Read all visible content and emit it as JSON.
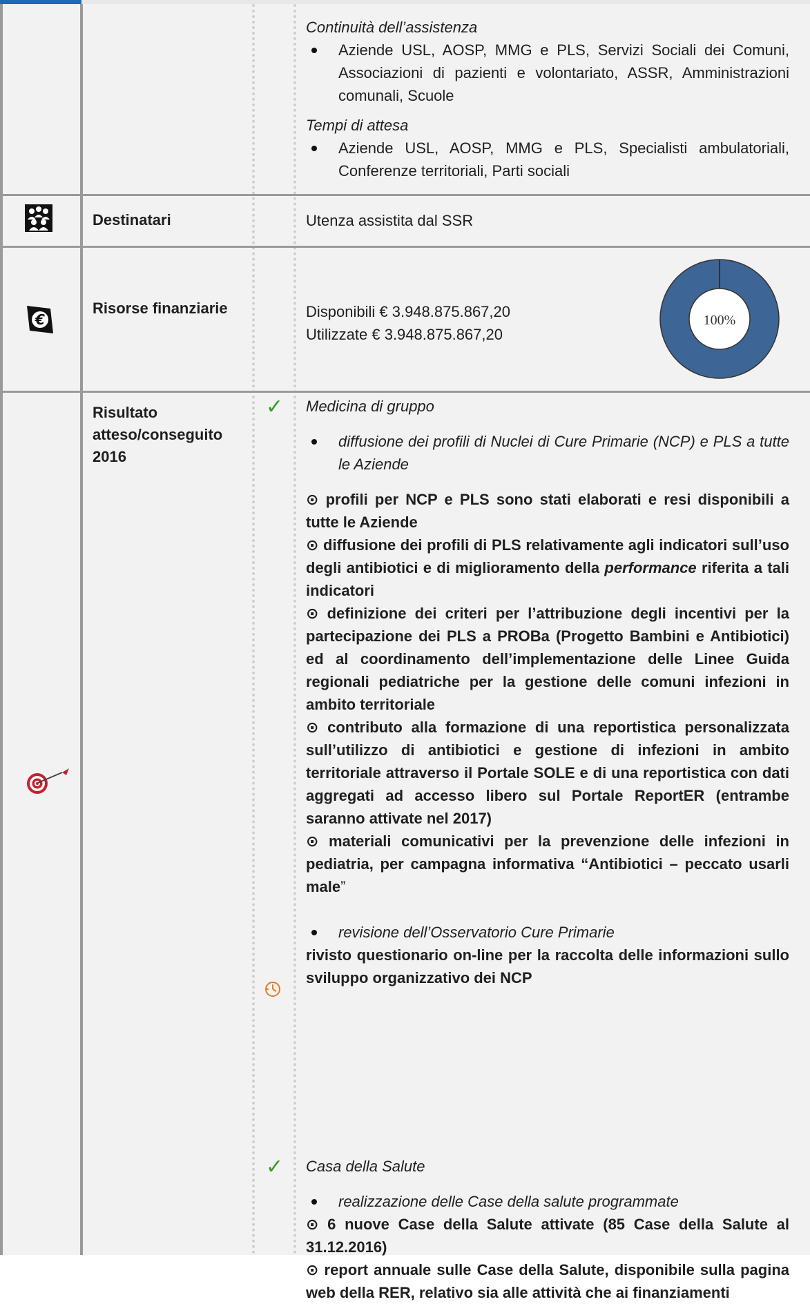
{
  "continuity": {
    "heading": "Continuità dell’assistenza",
    "item": "Aziende USL, AOSP, MMG e PLS, Servizi Sociali dei Comuni, Associazioni di pazienti e volontariato, ASSR, Amministrazioni comunali, Scuole"
  },
  "waiting": {
    "heading": "Tempi di attesa",
    "item": "Aziende USL, AOSP, MMG e PLS, Specialisti ambulatoriali, Conferenze territoriali, Parti sociali"
  },
  "recipients": {
    "label": "Destinatari",
    "value": "Utenza assistita dal SSR",
    "icon": "people-icon"
  },
  "resources": {
    "label": "Risorse finanziarie",
    "available": "Disponibili € 3.948.875.867,20",
    "used": "Utilizzate € 3.948.875.867,20",
    "icon": "euro-icon",
    "chart_data": {
      "type": "pie",
      "categories": [
        "Utilizzate"
      ],
      "values": [
        100
      ],
      "center_label": "100%",
      "colors": [
        "#3d6595"
      ]
    }
  },
  "results": {
    "label": "Risultato atteso/conseguito 2016",
    "icon": "target-icon",
    "status_colors": {
      "achieved": "#3a9a28",
      "in_progress": "#e87b1e"
    },
    "group": {
      "heading": "Medicina di gruppo",
      "bullet1": "diffusione dei profili di Nuclei di Cure Primarie (NCP) e PLS a tutte le Aziende",
      "o1": "⊙ profili per NCP e PLS sono stati elaborati e resi disponibili a tutte le Aziende",
      "o2a": "⊙ diffusione dei profili di PLS relativamente agli indicatori sull’uso degli antibiotici e di miglioramento della ",
      "o2b": "performance",
      "o2c": " riferita a tali indicatori",
      "o3": "⊙ definizione dei criteri per l’attribuzione degli incentivi per la partecipazione dei PLS a PROBa (Progetto Bambini e Antibiotici) ed al coordinamento dell’implementazione delle Linee Guida regionali pediatriche per la gestione delle comuni infezioni in ambito territoriale",
      "o4": "⊙ contributo alla formazione di una reportistica personalizzata sull’utilizzo di antibiotici e gestione di infezioni in ambito territoriale attraverso il Portale SOLE e di una reportistica con dati aggregati ad accesso libero sul Portale ReportER (entrambe saranno attivate nel 2017)",
      "o5a": "⊙ materiali comunicativi per la prevenzione delle infezioni in pediatria, per campagna informativa “Antibiotici – peccato usarli male",
      "o5b": "”",
      "bullet2": "revisione dell’Osservatorio Cure Primarie",
      "o6": "rivisto questionario on-line per la raccolta delle informazioni sullo sviluppo organizzativo dei NCP"
    },
    "house": {
      "heading": "Casa della Salute",
      "bullet1": "realizzazione delle Case della salute programmate",
      "o1": "⊙ 6 nuove Case della Salute attivate (85 Case della Salute al 31.12.2016)",
      "o2": "⊙ report annuale sulle Case della Salute, disponibile sulla pagina web della RER, relativo sia alle attività che ai finanziamenti"
    }
  }
}
